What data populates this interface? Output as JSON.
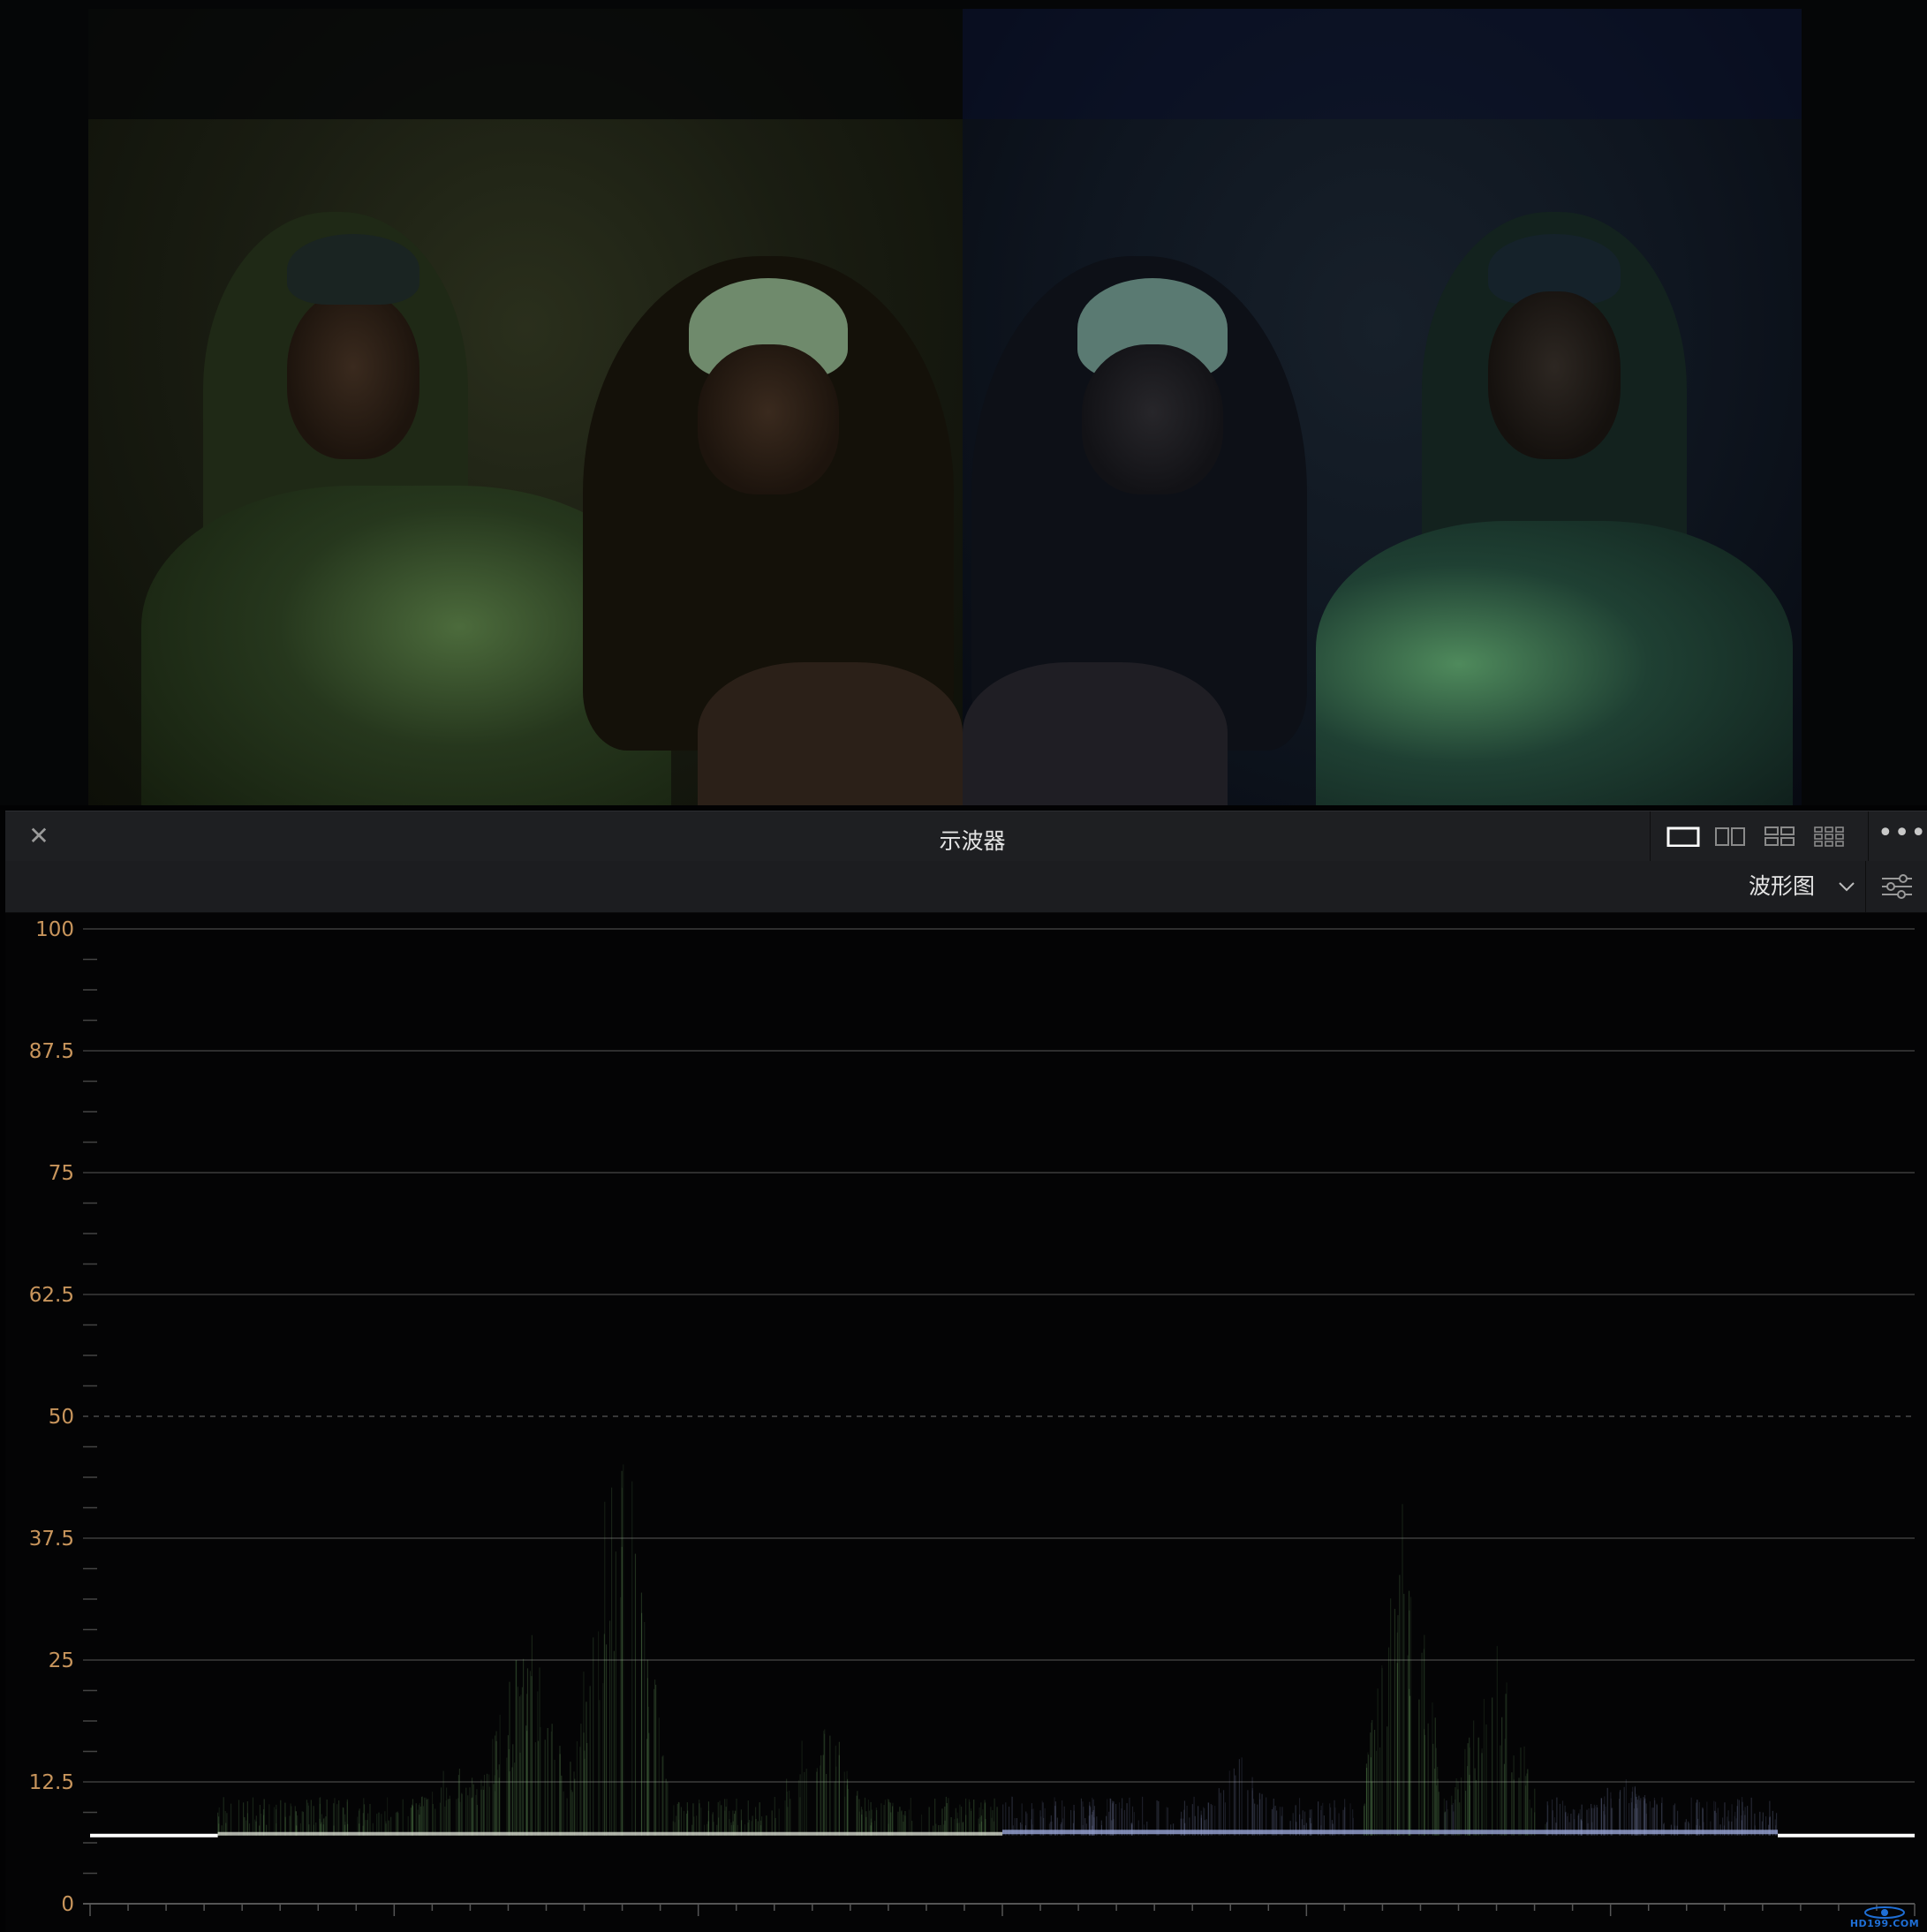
{
  "scope_panel": {
    "title": "示波器",
    "close_icon": "close-icon",
    "more_icon": "more-horizontal-icon",
    "layouts": [
      {
        "id": "single",
        "icon": "layout-single-icon",
        "active": true
      },
      {
        "id": "dual",
        "icon": "layout-dual-icon",
        "active": false
      },
      {
        "id": "quad",
        "icon": "layout-quad-icon",
        "active": false
      },
      {
        "id": "grid6",
        "icon": "layout-grid-icon",
        "active": false
      }
    ],
    "scope_type": "波形图",
    "settings_icon": "sliders-icon"
  },
  "waveform": {
    "y_ticks": [
      "100",
      "87.5",
      "75",
      "62.5",
      "50",
      "37.5",
      "25",
      "12.5",
      "0"
    ],
    "y_values": [
      100,
      87.5,
      75,
      62.5,
      50,
      37.5,
      25,
      12.5,
      0
    ],
    "dashed_line_value": 50,
    "label_color": "#c8955c",
    "grid_color": "#3c3c3c",
    "trace_baseline_value": 7,
    "trace_colors": {
      "left": "#7fbf72",
      "right": "#9aa6d8",
      "base": "#ffffff"
    }
  },
  "watermark": {
    "text": "HD199.COM"
  },
  "colors": {
    "panel_bg": "#1e1f22",
    "scope_bg": "#040405",
    "accent": "#c8955c"
  }
}
